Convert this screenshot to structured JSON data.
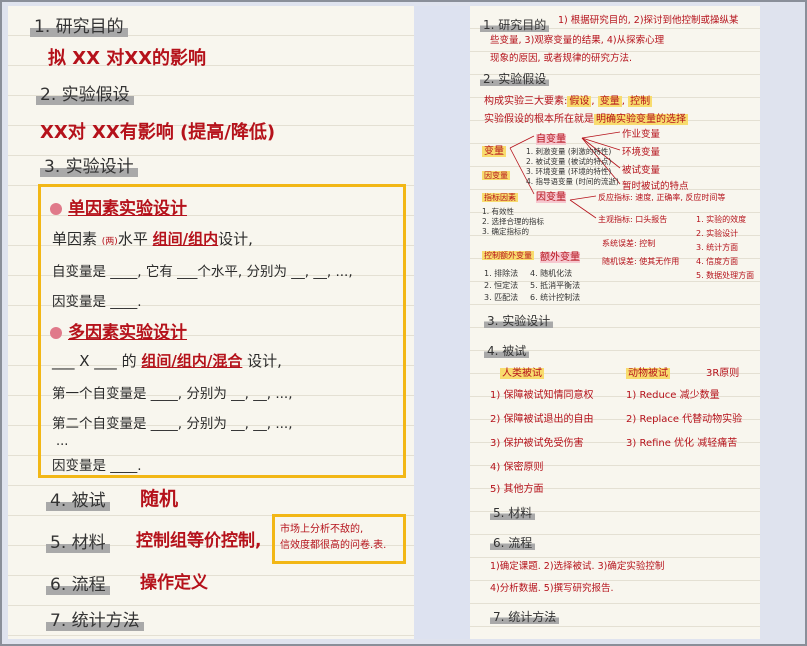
{
  "left": {
    "s1_heading": "1. 研究目的",
    "s1_body": "拟 XX 对XX的影响",
    "s2_heading": "2. 实验假设",
    "s2_body": "XX对 XX有影响 (提高/降低)",
    "s3_heading": "3. 实验设计",
    "single_title": "单因素实验设计",
    "single_l1_a": "单因素",
    "single_l1_b": "(两)",
    "single_l1_c": "水平",
    "single_l1_d": "组间/组内",
    "single_l1_e": "设计,",
    "single_l2": "自变量是 ____, 它有 ___个水平, 分别为 __, __, ...,",
    "single_l3": "因变量是 ____.",
    "multi_title": "多因素实验设计",
    "multi_l1_a": "___ X ___ 的",
    "multi_l1_b": "组间/组内/混合",
    "multi_l1_c": "设计,",
    "multi_l2": "第一个自变量是 ____, 分别为 __, __, ...,",
    "multi_l3": "第二个自变量是 ____, 分别为 __, __, ...,",
    "multi_l4": "...",
    "multi_l5": "因变量是 ____.",
    "s4_heading": "4. 被试",
    "s4_body": "随机",
    "s5_heading": "5. 材料",
    "s5_body": "控制组等价控制,",
    "s5_note_1": "市场上分析不敌的,",
    "s5_note_2": "信效度都很高的问卷.表.",
    "s6_heading": "6. 流程",
    "s6_body": "操作定义",
    "s7_heading": "7. 统计方法"
  },
  "right": {
    "r1_heading": "1. 研究目的",
    "r1_body_1": "1) 根据研究目的, 2)探讨到他控制或操纵某",
    "r1_body_2": "些变量, 3)观察变量的结果, 4)从探索心理",
    "r1_body_3": "现象的原因, 或者规律的研究方法.",
    "r2_heading": "2. 实验假设",
    "r2_l1_a": "构成实验三大要素:",
    "r2_l1_b": "假设",
    "r2_l1_c": "变量",
    "r2_l1_d": "控制",
    "r2_l2_a": "实验假设的根本所在就是",
    "r2_l2_b": "明确实验变量的选择",
    "var_label": "变量",
    "zi": "自变量",
    "zi_sub1": "1. 刺激变量 (刺激的特性)",
    "zi_sub2": "2. 被试变量 (被试的特点)",
    "zi_sub3": "3. 环境变量 (环境的特性)",
    "zi_sub4": "4. 指导语变量 (时间的流逝)",
    "ind_label": "因变量",
    "cats": [
      "作业变量",
      "环境变量",
      "被试变量",
      "暂时被试的特点"
    ],
    "measure_label": "指标因素",
    "measure_1": "1. 有效性",
    "measure_2": "2. 选择合理的指标",
    "measure_3": "3. 确定指标的",
    "yin": "因变量",
    "yin_note_1": "反应指标: 速度, 正确率, 反应时间等",
    "yin_note_2": "主观指标: 口头报告",
    "ctrl_label": "控制额外变量",
    "ctrl_l1": "1. 排除法",
    "ctrl_l2": "2. 恒定法",
    "ctrl_l3": "3. 匹配法",
    "ctrl_r1": "4. 随机化法",
    "ctrl_r2": "5. 抵消平衡法",
    "ctrl_r3": "6. 统计控制法",
    "extra": "额外变量",
    "extra_n1": "系统误差: 控制",
    "extra_n2": "随机误差: 使其无作用",
    "design_list": [
      "1. 实验的效度",
      "2. 实验设计",
      "3. 统计方面",
      "4. 信度方面",
      "5. 数据处理方面"
    ],
    "r3_heading": "3. 实验设计",
    "r4_heading": "4. 被试",
    "ethics_label": "人类被试",
    "ethics": [
      "1) 保障被试知情同意权",
      "2) 保障被试退出的自由",
      "3) 保护被试免受伤害",
      "4) 保密原则",
      "5) 其他方面"
    ],
    "animal_label": "动物被试",
    "animal_3r": "3R原则",
    "animal": [
      "1) Reduce 减少数量",
      "2) Replace 代替动物实验",
      "3) Refine 优化 减轻痛苦"
    ],
    "r5_heading": "5. 材料",
    "r6_heading": "6. 流程",
    "flow_1": "1)确定课题. 2)选择被试. 3)确定实验控制",
    "flow_2": "4)分析数据. 5)撰写研究报告.",
    "r7_heading": "7. 统计方法"
  },
  "colors": {
    "ink_red": "#b5121b",
    "highlight_yellow": "#f2b716",
    "highlight_gray": "#a9a9a9",
    "paper": "#f8f6ee"
  }
}
